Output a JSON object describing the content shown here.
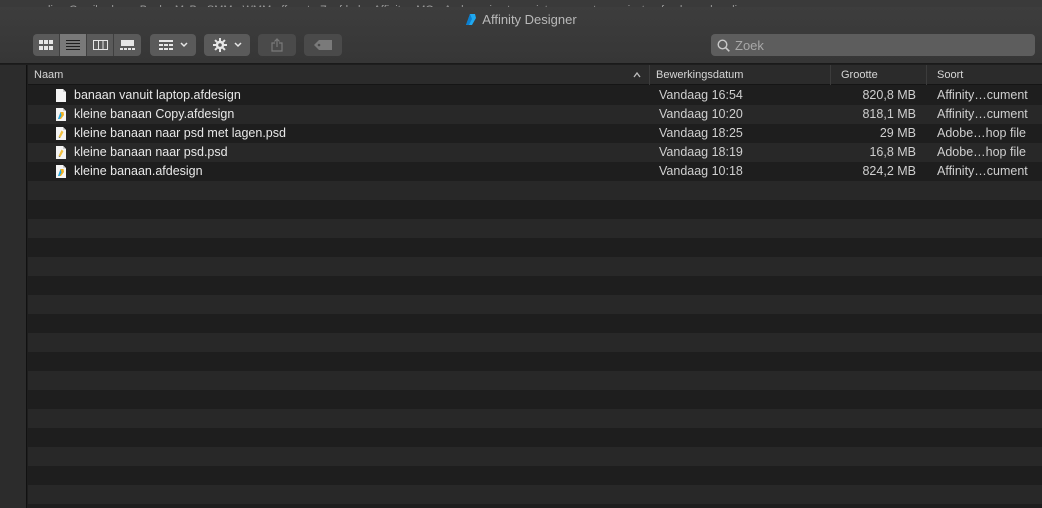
{
  "bookmarks": [
    "es",
    "amelia",
    "Gmail",
    "door",
    "Book",
    "MyB",
    "SMM",
    "WMM",
    "ff",
    "art",
    "Zeefdruk",
    "Affinity",
    "MO",
    "Arab",
    "animate",
    "printen",
    "vacatures",
    "insta",
    "fondsen",
    "handige s"
  ],
  "window": {
    "title": "Affinity Designer",
    "accent": "#1fa8f0"
  },
  "toolbar": {
    "view_buttons": [
      "icon-view",
      "list-view",
      "column-view",
      "gallery-view"
    ],
    "active_view": "list-view"
  },
  "search": {
    "placeholder": "Zoek"
  },
  "columns": {
    "name": "Naam",
    "date": "Bewerkingsdatum",
    "size": "Grootte",
    "kind": "Soort"
  },
  "files": [
    {
      "name": "banaan vanuit laptop.afdesign",
      "date": "Vandaag 16:54",
      "size": "820,8 MB",
      "kind": "Affinity…cument",
      "icon": "blank-document-icon"
    },
    {
      "name": "kleine banaan Copy.afdesign",
      "date": "Vandaag 10:20",
      "size": "818,1 MB",
      "kind": "Affinity…cument",
      "icon": "afdesign-document-icon"
    },
    {
      "name": "kleine banaan naar psd met lagen.psd",
      "date": "Vandaag 18:25",
      "size": "29 MB",
      "kind": "Adobe…hop file",
      "icon": "psd-document-icon"
    },
    {
      "name": "kleine banaan naar psd.psd",
      "date": "Vandaag 18:19",
      "size": "16,8 MB",
      "kind": "Adobe…hop file",
      "icon": "psd-document-icon"
    },
    {
      "name": "kleine banaan.afdesign",
      "date": "Vandaag 10:18",
      "size": "824,2 MB",
      "kind": "Affinity…cument",
      "icon": "afdesign-document-icon"
    }
  ]
}
